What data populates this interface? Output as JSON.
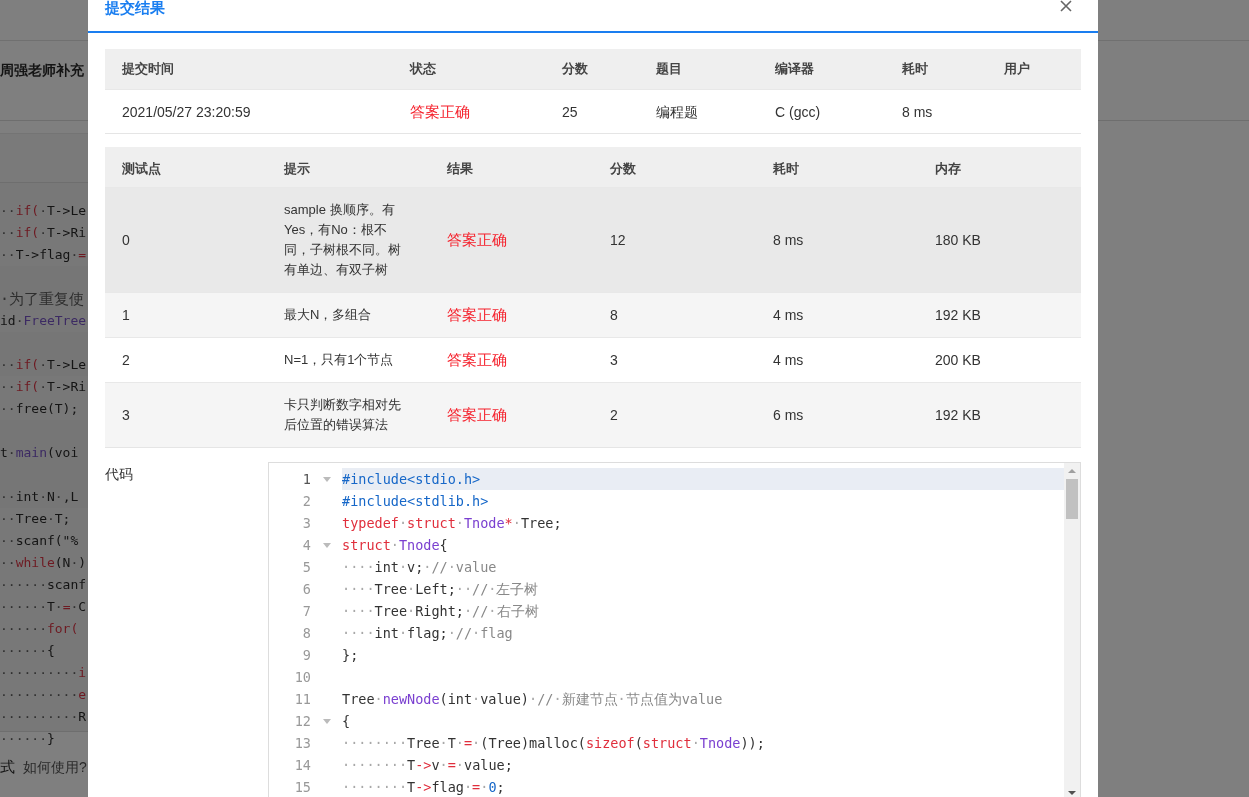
{
  "background_page": {
    "heading": "周强老师补充",
    "code_lines": [
      {
        "tokens": [
          {
            "kind": "p",
            "text": "··"
          },
          {
            "kind": "kw",
            "text": "if("
          },
          {
            "kind": "p",
            "text": "·T->Le"
          }
        ]
      },
      {
        "tokens": [
          {
            "kind": "p",
            "text": "··"
          },
          {
            "kind": "kw",
            "text": "if("
          },
          {
            "kind": "p",
            "text": "·T->Ri"
          }
        ]
      },
      {
        "tokens": [
          {
            "kind": "p",
            "text": "··T->flag·"
          },
          {
            "kind": "kw",
            "text": "="
          }
        ]
      },
      {
        "blank_before": true,
        "tokens": [
          {
            "kind": "cm",
            "text": "·为了重复使"
          }
        ]
      },
      {
        "tokens": [
          {
            "kind": "p",
            "text": "id·"
          },
          {
            "kind": "ty",
            "text": "FreeTree"
          }
        ]
      },
      {
        "blank_before": true,
        "tokens": [
          {
            "kind": "p",
            "text": "··"
          },
          {
            "kind": "kw",
            "text": "if("
          },
          {
            "kind": "p",
            "text": "·T->Le"
          }
        ]
      },
      {
        "tokens": [
          {
            "kind": "p",
            "text": "··"
          },
          {
            "kind": "kw",
            "text": "if("
          },
          {
            "kind": "p",
            "text": "·T->Ri"
          }
        ]
      },
      {
        "tokens": [
          {
            "kind": "p",
            "text": "··free(T);"
          }
        ]
      },
      {
        "blank_before": true,
        "tokens": [
          {
            "kind": "p",
            "text": "t·"
          },
          {
            "kind": "ty",
            "text": "main"
          },
          {
            "kind": "p",
            "text": "(voi"
          }
        ]
      },
      {
        "blank_before": true,
        "tokens": [
          {
            "kind": "p",
            "text": "··int·N·,L"
          }
        ]
      },
      {
        "tokens": [
          {
            "kind": "p",
            "text": "··Tree·T;"
          }
        ]
      },
      {
        "tokens": [
          {
            "kind": "p",
            "text": "··scanf(\"%"
          }
        ]
      },
      {
        "tokens": [
          {
            "kind": "p",
            "text": "··"
          },
          {
            "kind": "kw",
            "text": "while"
          },
          {
            "kind": "p",
            "text": "(N·)"
          }
        ]
      },
      {
        "tokens": [
          {
            "kind": "p",
            "text": "······scanf"
          }
        ]
      },
      {
        "tokens": [
          {
            "kind": "p",
            "text": "······T·"
          },
          {
            "kind": "kw",
            "text": "="
          },
          {
            "kind": "p",
            "text": "·C"
          }
        ]
      },
      {
        "tokens": [
          {
            "kind": "p",
            "text": "······"
          },
          {
            "kind": "kw",
            "text": "for("
          }
        ]
      },
      {
        "tokens": [
          {
            "kind": "p",
            "text": "······{"
          }
        ]
      },
      {
        "tokens": [
          {
            "kind": "p",
            "text": "··········"
          },
          {
            "kind": "kw",
            "text": "i"
          }
        ]
      },
      {
        "tokens": [
          {
            "kind": "p",
            "text": "··········"
          },
          {
            "kind": "kw",
            "text": "e"
          }
        ]
      },
      {
        "tokens": [
          {
            "kind": "p",
            "text": "··········R"
          }
        ]
      },
      {
        "tokens": [
          {
            "kind": "p",
            "text": "······}"
          }
        ]
      }
    ],
    "footer": [
      "式",
      "如何使用?"
    ]
  },
  "dialog": {
    "title": "提交结果",
    "summary": {
      "columns": [
        {
          "label": "提交时间",
          "kind": "text"
        },
        {
          "label": "状态",
          "kind": "status"
        },
        {
          "label": "分数",
          "kind": "text"
        },
        {
          "label": "题目",
          "kind": "text"
        },
        {
          "label": "编译器",
          "kind": "text"
        },
        {
          "label": "耗时",
          "kind": "text"
        },
        {
          "label": "用户",
          "kind": "text"
        }
      ],
      "rows": [
        {
          "highlighted": false,
          "cells": [
            "2021/05/27 23:20:59",
            "答案正确",
            "25",
            "编程题",
            "C (gcc)",
            "8 ms"
          ]
        }
      ]
    },
    "tests": {
      "columns": [
        {
          "label": "测试点",
          "kind": "text"
        },
        {
          "label": "提示",
          "kind": "text"
        },
        {
          "label": "结果",
          "kind": "status"
        },
        {
          "label": "分数",
          "kind": "text"
        },
        {
          "label": "耗时",
          "kind": "text"
        },
        {
          "label": "内存",
          "kind": "text"
        }
      ],
      "rows": [
        {
          "highlighted": true,
          "cells": [
            "0",
            "sample 换顺序。有Yes，有No：根不同，子树根不同。树有单边、有双子树",
            "答案正确",
            "12",
            "8 ms",
            "180 KB"
          ]
        },
        {
          "highlighted": false,
          "cells": [
            "1",
            "最大N，多组合",
            "答案正确",
            "8",
            "4 ms",
            "192 KB"
          ]
        },
        {
          "highlighted": false,
          "cells": [
            "2",
            "N=1，只有1个节点",
            "答案正确",
            "3",
            "4 ms",
            "200 KB"
          ]
        },
        {
          "highlighted": false,
          "cells": [
            "3",
            "卡只判断数字相对先后位置的错误算法",
            "答案正确",
            "2",
            "6 ms",
            "192 KB"
          ]
        }
      ]
    },
    "code_label": "代码",
    "code_lines": [
      {
        "number": "1",
        "fold": true,
        "active": true,
        "tokens": [
          {
            "kind": "pp",
            "text": "#include<stdio.h>"
          }
        ]
      },
      {
        "number": "2",
        "fold": false,
        "active": false,
        "tokens": [
          {
            "kind": "pp",
            "text": "#include<stdlib.h>"
          }
        ]
      },
      {
        "number": "3",
        "fold": false,
        "active": false,
        "tokens": [
          {
            "kind": "kw",
            "text": "typedef·struct·"
          },
          {
            "kind": "ty",
            "text": "Tnode"
          },
          {
            "kind": "kw",
            "text": "*"
          },
          {
            "kind": "p",
            "text": "·Tree;"
          }
        ]
      },
      {
        "number": "4",
        "fold": true,
        "active": false,
        "tokens": [
          {
            "kind": "kw",
            "text": "struct·"
          },
          {
            "kind": "ty",
            "text": "Tnode"
          },
          {
            "kind": "p",
            "text": "{"
          }
        ]
      },
      {
        "number": "5",
        "fold": false,
        "active": false,
        "tokens": [
          {
            "kind": "p",
            "text": "····int·v;·"
          },
          {
            "kind": "cm",
            "text": "//·value"
          }
        ]
      },
      {
        "number": "6",
        "fold": false,
        "active": false,
        "tokens": [
          {
            "kind": "p",
            "text": "····Tree·Left;··"
          },
          {
            "kind": "cm",
            "text": "//·左子树"
          }
        ]
      },
      {
        "number": "7",
        "fold": false,
        "active": false,
        "tokens": [
          {
            "kind": "p",
            "text": "····Tree·Right;·"
          },
          {
            "kind": "cm",
            "text": "//·右子树"
          }
        ]
      },
      {
        "number": "8",
        "fold": false,
        "active": false,
        "tokens": [
          {
            "kind": "p",
            "text": "····int·flag;·"
          },
          {
            "kind": "cm",
            "text": "//·flag"
          }
        ]
      },
      {
        "number": "9",
        "fold": false,
        "active": false,
        "tokens": [
          {
            "kind": "p",
            "text": "};"
          }
        ]
      },
      {
        "number": "10",
        "fold": false,
        "active": false
      },
      {
        "number": "11",
        "fold": false,
        "active": false,
        "tokens": [
          {
            "kind": "p",
            "text": "Tree·"
          },
          {
            "kind": "ty",
            "text": "newNode"
          },
          {
            "kind": "p",
            "text": "(int·value)·"
          },
          {
            "kind": "cm",
            "text": "//·新建节点·节点值为value"
          }
        ]
      },
      {
        "number": "12",
        "fold": true,
        "active": false,
        "tokens": [
          {
            "kind": "p",
            "text": "{"
          }
        ]
      },
      {
        "number": "13",
        "fold": false,
        "active": false,
        "tokens": [
          {
            "kind": "p",
            "text": "········Tree·T·"
          },
          {
            "kind": "kw",
            "text": "="
          },
          {
            "kind": "p",
            "text": "·(Tree)malloc("
          },
          {
            "kind": "kw",
            "text": "sizeof"
          },
          {
            "kind": "p",
            "text": "("
          },
          {
            "kind": "kw",
            "text": "struct"
          },
          {
            "kind": "p",
            "text": "·"
          },
          {
            "kind": "ty",
            "text": "Tnode"
          },
          {
            "kind": "p",
            "text": "));"
          }
        ]
      },
      {
        "number": "14",
        "fold": false,
        "active": false,
        "tokens": [
          {
            "kind": "p",
            "text": "········T"
          },
          {
            "kind": "kw",
            "text": "->"
          },
          {
            "kind": "p",
            "text": "v·"
          },
          {
            "kind": "kw",
            "text": "="
          },
          {
            "kind": "p",
            "text": "·value;"
          }
        ]
      },
      {
        "number": "15",
        "fold": false,
        "active": false,
        "tokens": [
          {
            "kind": "p",
            "text": "········T"
          },
          {
            "kind": "kw",
            "text": "->"
          },
          {
            "kind": "p",
            "text": "flag·"
          },
          {
            "kind": "kw",
            "text": "="
          },
          {
            "kind": "p",
            "text": "·"
          },
          {
            "kind": "num",
            "text": "0"
          },
          {
            "kind": "p",
            "text": ";"
          }
        ]
      }
    ]
  }
}
